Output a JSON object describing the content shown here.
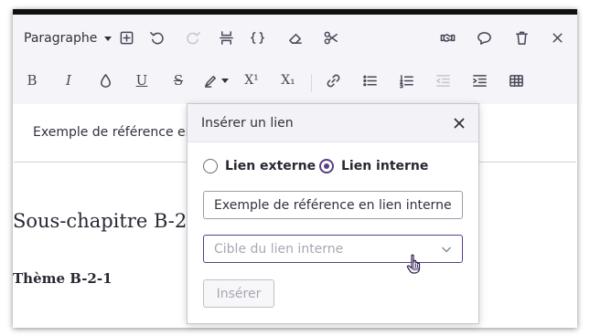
{
  "toolbar": {
    "paragraph_select": "Paragraphe",
    "row1_icons": [
      "insert-block-icon",
      "undo-icon",
      "redo-icon",
      "page-break-icon",
      "code-braces-icon",
      "eraser-icon",
      "scissors-icon",
      "handshake-icon",
      "comment-icon",
      "trash-icon",
      "close-icon"
    ],
    "row2_icons": [
      "bold-icon",
      "italic-icon",
      "ink-drop-icon",
      "underline-icon",
      "strikethrough-icon",
      "highlighter-icon",
      "superscript-icon",
      "subscript-icon",
      "link-icon",
      "bulleted-list-icon",
      "numbered-list-icon",
      "outdent-icon",
      "indent-icon",
      "table-icon"
    ],
    "bold_label": "B",
    "italic_label": "I",
    "underline_label": "U",
    "strike_label": "S",
    "superscript_label": "X¹",
    "subscript_label": "X₁"
  },
  "editor": {
    "reference_text": "Exemple de référence en lien interne",
    "heading_subchapter": "Sous-chapitre B-2",
    "heading_theme": "Thème B-2-1"
  },
  "link_dialog": {
    "title": "Insérer un lien",
    "radio_external": "Lien externe",
    "radio_internal": "Lien interne",
    "selected": "Lien interne",
    "text_value": "Exemple de référence en lien interne",
    "target_placeholder": "Cible du lien interne",
    "insert_label": "Insérer"
  },
  "colors": {
    "accent": "#5a3e87",
    "toolbar_bg": "#f5f4f8",
    "text": "#33303d"
  }
}
